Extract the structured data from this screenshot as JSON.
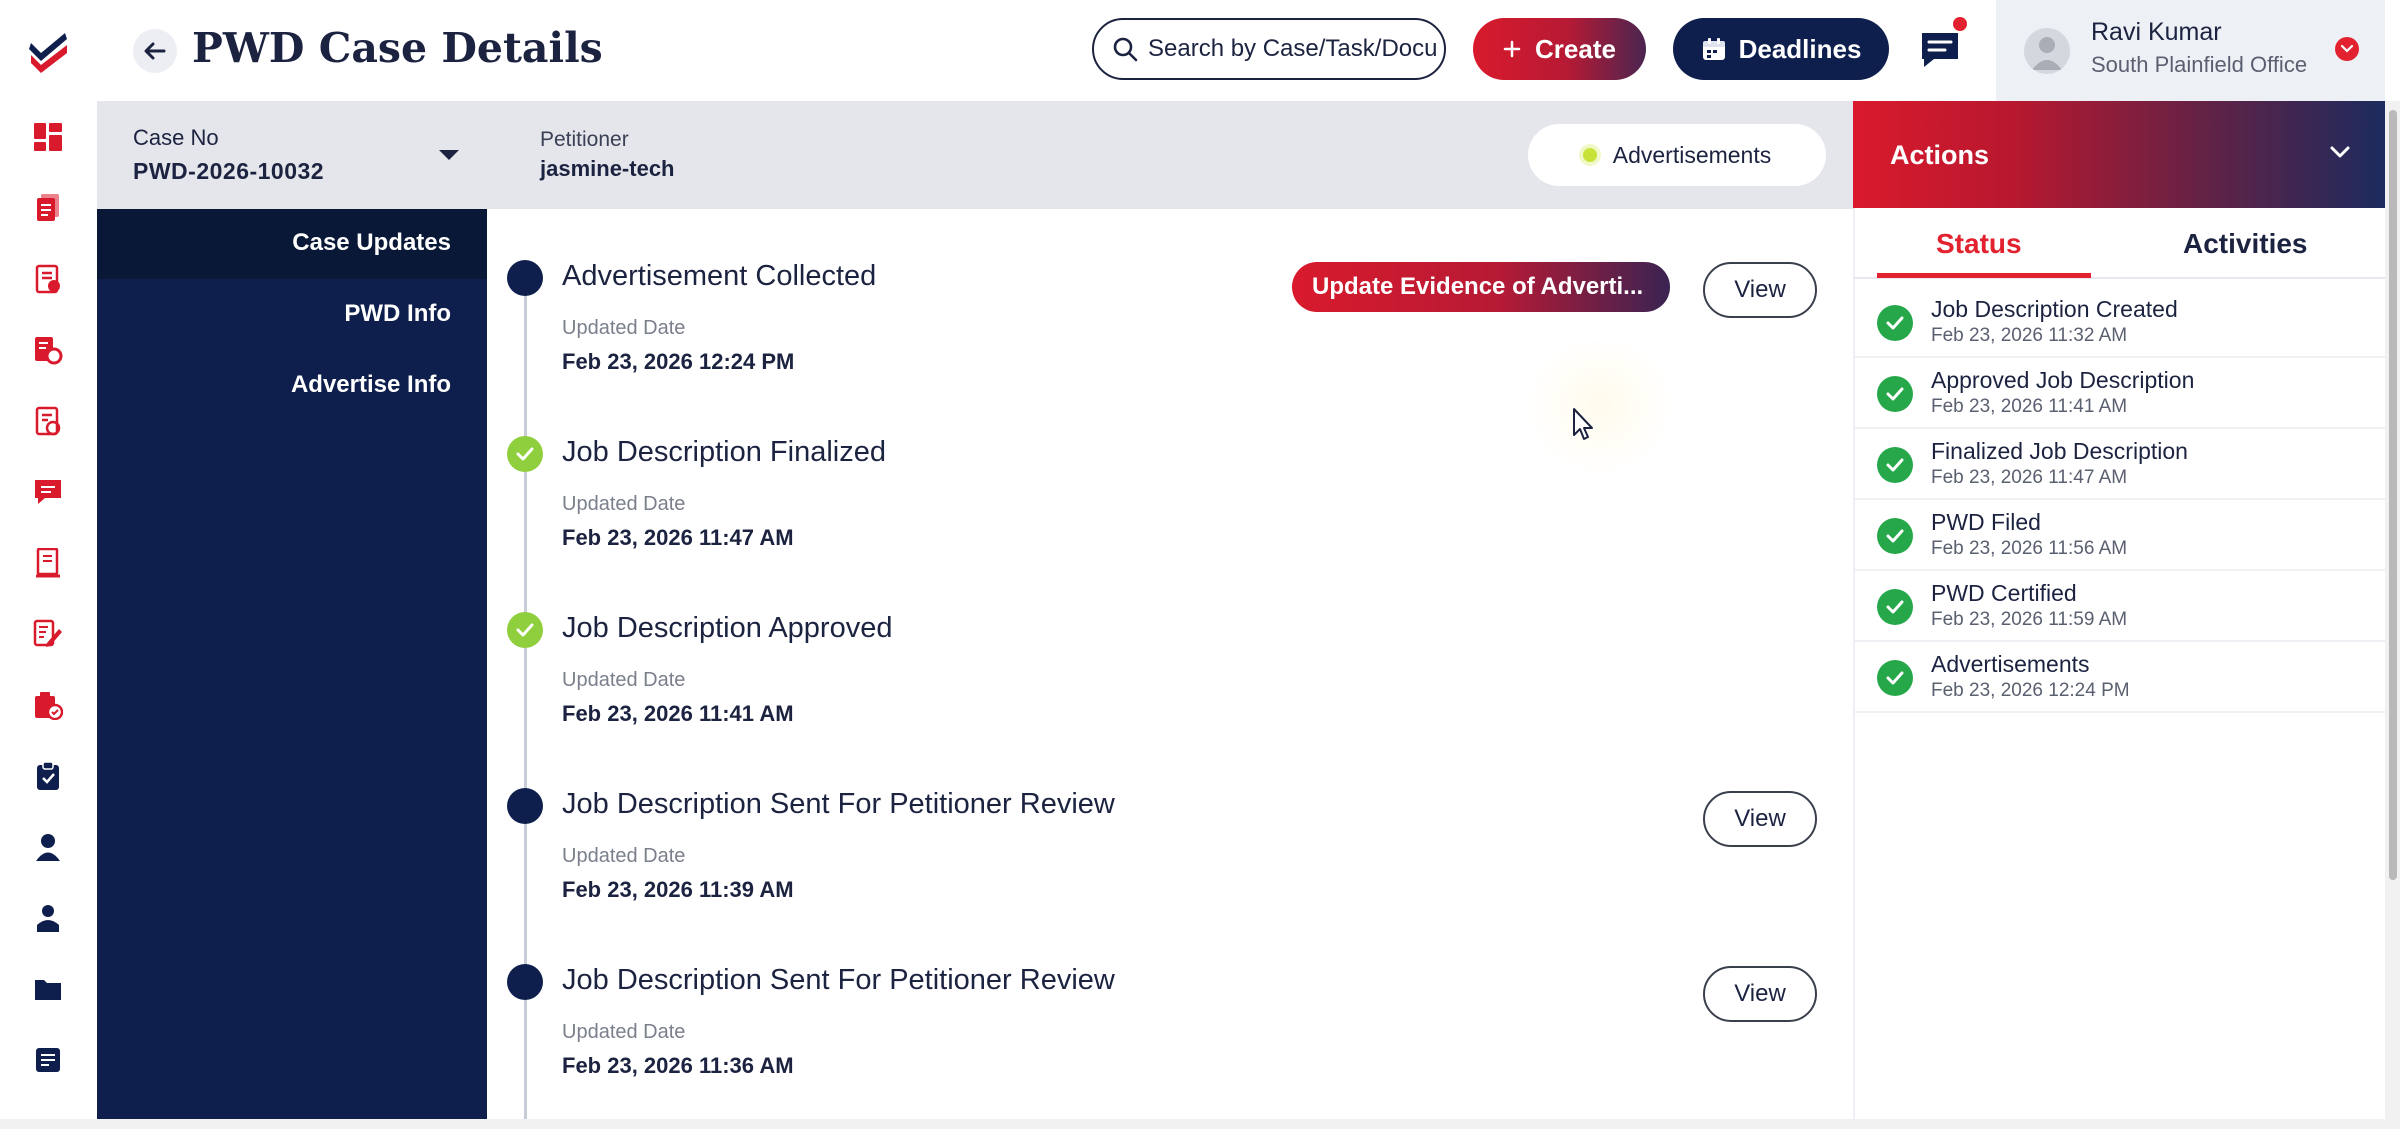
{
  "colors": {
    "brand_red": "#d91a2c",
    "navy": "#0f1f4d",
    "success_green": "#26a84a",
    "timeline_green": "#8fce3d",
    "status_accent": "#e2232f"
  },
  "header": {
    "title": "PWD Case Details",
    "back_icon": "arrow-left-icon",
    "search_placeholder": "Search by Case/Task/Document",
    "create_label": "Create",
    "deadlines_label": "Deadlines"
  },
  "user": {
    "name": "Ravi Kumar",
    "office": "South Plainfield Office"
  },
  "rail": {
    "icons": [
      "dashboard-icon",
      "documents-icon",
      "case-list-icon",
      "case-settings-icon",
      "approved-doc-icon",
      "messages-icon",
      "ledger-icon",
      "edit-doc-icon",
      "verified-folder-icon",
      "clipboard-icon",
      "user-icon",
      "contact-icon",
      "folder-icon",
      "notes-icon"
    ]
  },
  "case": {
    "no_label": "Case No",
    "no_value": "PWD-2026-10032",
    "petitioner_label": "Petitioner",
    "petitioner_value": "jasmine-tech",
    "stage_pill": "Advertisements"
  },
  "subnav": {
    "items": [
      {
        "label": "Case Updates"
      },
      {
        "label": "PWD Info"
      },
      {
        "label": "Advertise Info"
      }
    ]
  },
  "timeline": {
    "date_label": "Updated Date",
    "view_label": "View",
    "update_evidence_label": "Update Evidence of Adverti...",
    "entries": [
      {
        "title": "Advertisement Collected",
        "date": "Feb 23, 2026 12:24 PM",
        "state": "current"
      },
      {
        "title": "Job Description Finalized",
        "date": "Feb 23, 2026 11:47 AM",
        "state": "done"
      },
      {
        "title": "Job Description Approved",
        "date": "Feb 23, 2026 11:41 AM",
        "state": "done"
      },
      {
        "title": "Job Description Sent For Petitioner Review",
        "date": "Feb 23, 2026 11:39 AM",
        "state": "current"
      },
      {
        "title": "Job Description Sent For Petitioner Review",
        "date": "Feb 23, 2026 11:36 AM",
        "state": "current"
      }
    ]
  },
  "actions": {
    "title": "Actions",
    "tabs": [
      {
        "label": "Status"
      },
      {
        "label": "Activities"
      }
    ],
    "active_tab": "Status",
    "status_items": [
      {
        "name": "Job Description Created",
        "time": "Feb 23, 2026 11:32 AM"
      },
      {
        "name": "Approved Job Description",
        "time": "Feb 23, 2026 11:41 AM"
      },
      {
        "name": "Finalized Job Description",
        "time": "Feb 23, 2026 11:47 AM"
      },
      {
        "name": "PWD Filed",
        "time": "Feb 23, 2026 11:56 AM"
      },
      {
        "name": "PWD Certified",
        "time": "Feb 23, 2026 11:59 AM"
      },
      {
        "name": "Advertisements",
        "time": "Feb 23, 2026 12:24 PM"
      }
    ]
  }
}
